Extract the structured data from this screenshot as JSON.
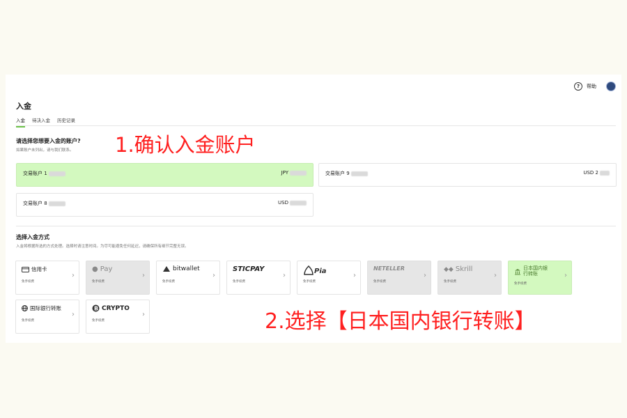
{
  "header": {
    "help_label": "帮助"
  },
  "page": {
    "title": "入金",
    "tabs": [
      {
        "label": "入金",
        "active": true
      },
      {
        "label": "待决入金",
        "active": false
      },
      {
        "label": "历史记录",
        "active": false
      }
    ]
  },
  "accounts_section": {
    "heading": "请选择您想要入金的账户?",
    "subtext": "如果账户未列出，请与我们联系。",
    "accounts": [
      {
        "name": "交易账户 1",
        "currency": "JPY",
        "selected": true
      },
      {
        "name": "交易账户 9",
        "currency": "USD 2",
        "selected": false
      },
      {
        "name": "交易账户 8",
        "currency": "USD",
        "selected": false
      }
    ]
  },
  "methods_section": {
    "heading": "选择入金方式",
    "subtext": "入金将根据所选的方式处理。选择时请注意时间。为尽可能避免任何延迟，请确保所有细节完整无误。",
    "methods": [
      {
        "label": "信用卡",
        "fee": "免手续费",
        "icon": "credit-card-icon",
        "disabled": false
      },
      {
        "label": "Pay",
        "fee": "免手续费",
        "icon": "apple-icon",
        "disabled": true
      },
      {
        "label": "bitwallet",
        "fee": "免手续费",
        "icon": "bitwallet-icon",
        "disabled": false
      },
      {
        "label": "STICPAY",
        "fee": "免手续费",
        "icon": "sticpay-logo",
        "disabled": false
      },
      {
        "label": "Piastrix",
        "fee": "免手续费",
        "icon": "piastrix-logo",
        "disabled": false
      },
      {
        "label": "NETELLER",
        "fee": "免手续费",
        "icon": "neteller-logo",
        "disabled": true
      },
      {
        "label": "Skrill",
        "fee": "免手续费",
        "icon": "skrill-icon",
        "disabled": true
      },
      {
        "label": "日本国内银行转账",
        "fee": "免手续费",
        "icon": "bank-icon",
        "disabled": false,
        "highlighted": true
      },
      {
        "label": "国际银行转账",
        "fee": "免手续费",
        "icon": "globe-icon",
        "disabled": false
      },
      {
        "label": "CRYPTO",
        "fee": "免手续费",
        "icon": "bitcoin-icon",
        "disabled": false
      }
    ]
  },
  "annotations": {
    "step1": "1.确认入金账户",
    "step2": "2.选择【日本国内银行转账】",
    "color": "#ff2020"
  }
}
